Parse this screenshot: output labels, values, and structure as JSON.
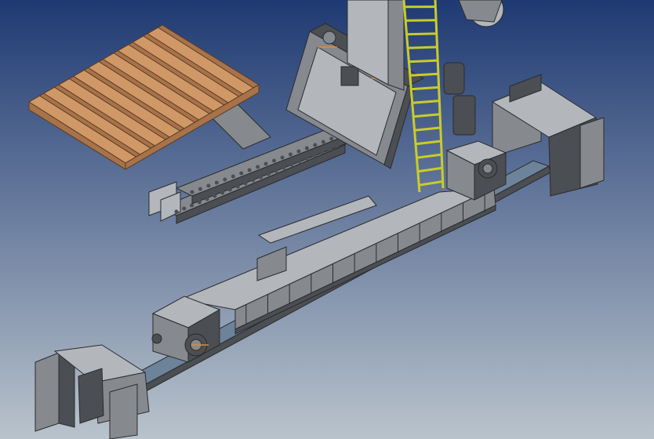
{
  "viewport": {
    "background": {
      "top_color": "#1f3a73",
      "bottom_color": "#b9c3cc"
    }
  },
  "palette": {
    "steel_light": "#b3b6ba",
    "steel_mid": "#86898d",
    "steel_dark": "#4b4e52",
    "edge": "#2a2c2f",
    "wood_top": "#cf9866",
    "wood_side": "#a8734a",
    "ladder": "#c9cc2a",
    "rail": "#6d8399",
    "marker": "#e08a30"
  },
  "scene": {
    "description_icons": [
      "pallet",
      "tilting-frame",
      "ladder",
      "column-mast",
      "base-track-beam",
      "end-carriage",
      "end-stop-frame",
      "roller-conveyor"
    ]
  }
}
